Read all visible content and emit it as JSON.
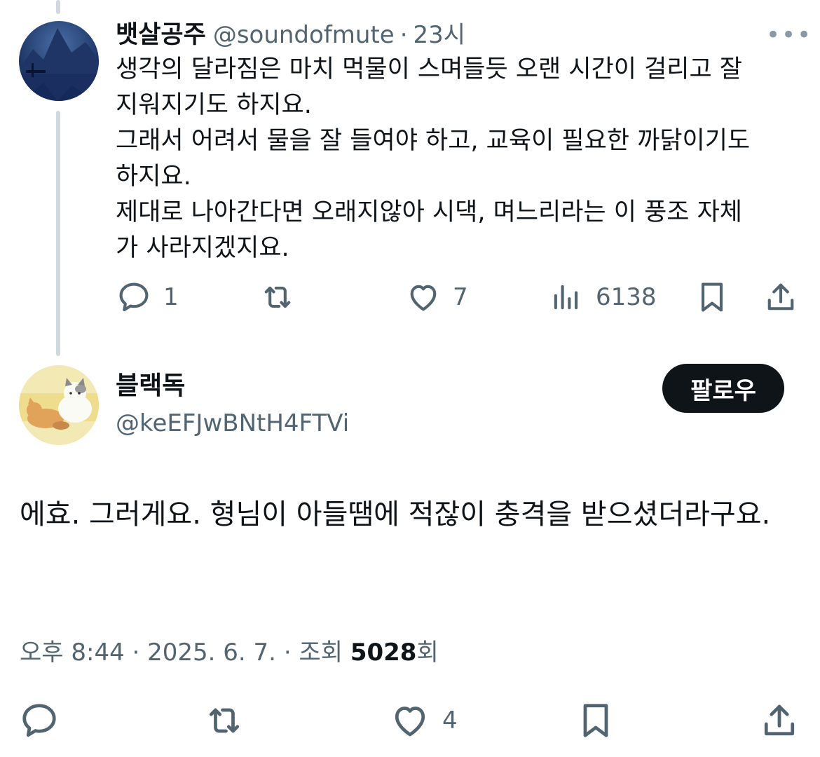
{
  "parent": {
    "display_name": "뱃살공주",
    "handle": "@soundofmute",
    "time": "23시",
    "more_label": "•••",
    "text": "생각의 달라짐은 마치 먹물이 스며들듯 오랜 시간이 걸리고 잘\n지워지기도 하지요.\n그래서 어려서 물을 잘 들여야 하고, 교육이 필요한 까닭이기도\n하지요.\n제대로 나아간다면 오래지않아 시댁, 며느리라는 이 풍조 자체\n가 사라지겠지요.",
    "actions": {
      "reply_count": "1",
      "repost_count": "",
      "like_count": "7",
      "views_count": "6138"
    },
    "icons": [
      "reply-icon",
      "repost-icon",
      "heart-icon",
      "views-icon",
      "bookmark-icon",
      "share-icon"
    ]
  },
  "tweet": {
    "display_name": "블랙독",
    "handle": "@keEFJwBNtH4FTVi",
    "follow_label": "팔로우",
    "text": "에효. 그러게요. 형님이 아들땜에 적잖이 충격을 받으셨더라구요.",
    "time": "오후 8:44",
    "date": "2025. 6. 7.",
    "views_label": "조회",
    "views_count": "5028",
    "views_suffix": "회",
    "actions": {
      "reply_count": "",
      "repost_count": "",
      "like_count": "4"
    }
  },
  "colors": {
    "text": "#0f1419",
    "secondary": "#536471",
    "thread_line": "#cfd9de",
    "follow_bg": "#0f1419"
  }
}
